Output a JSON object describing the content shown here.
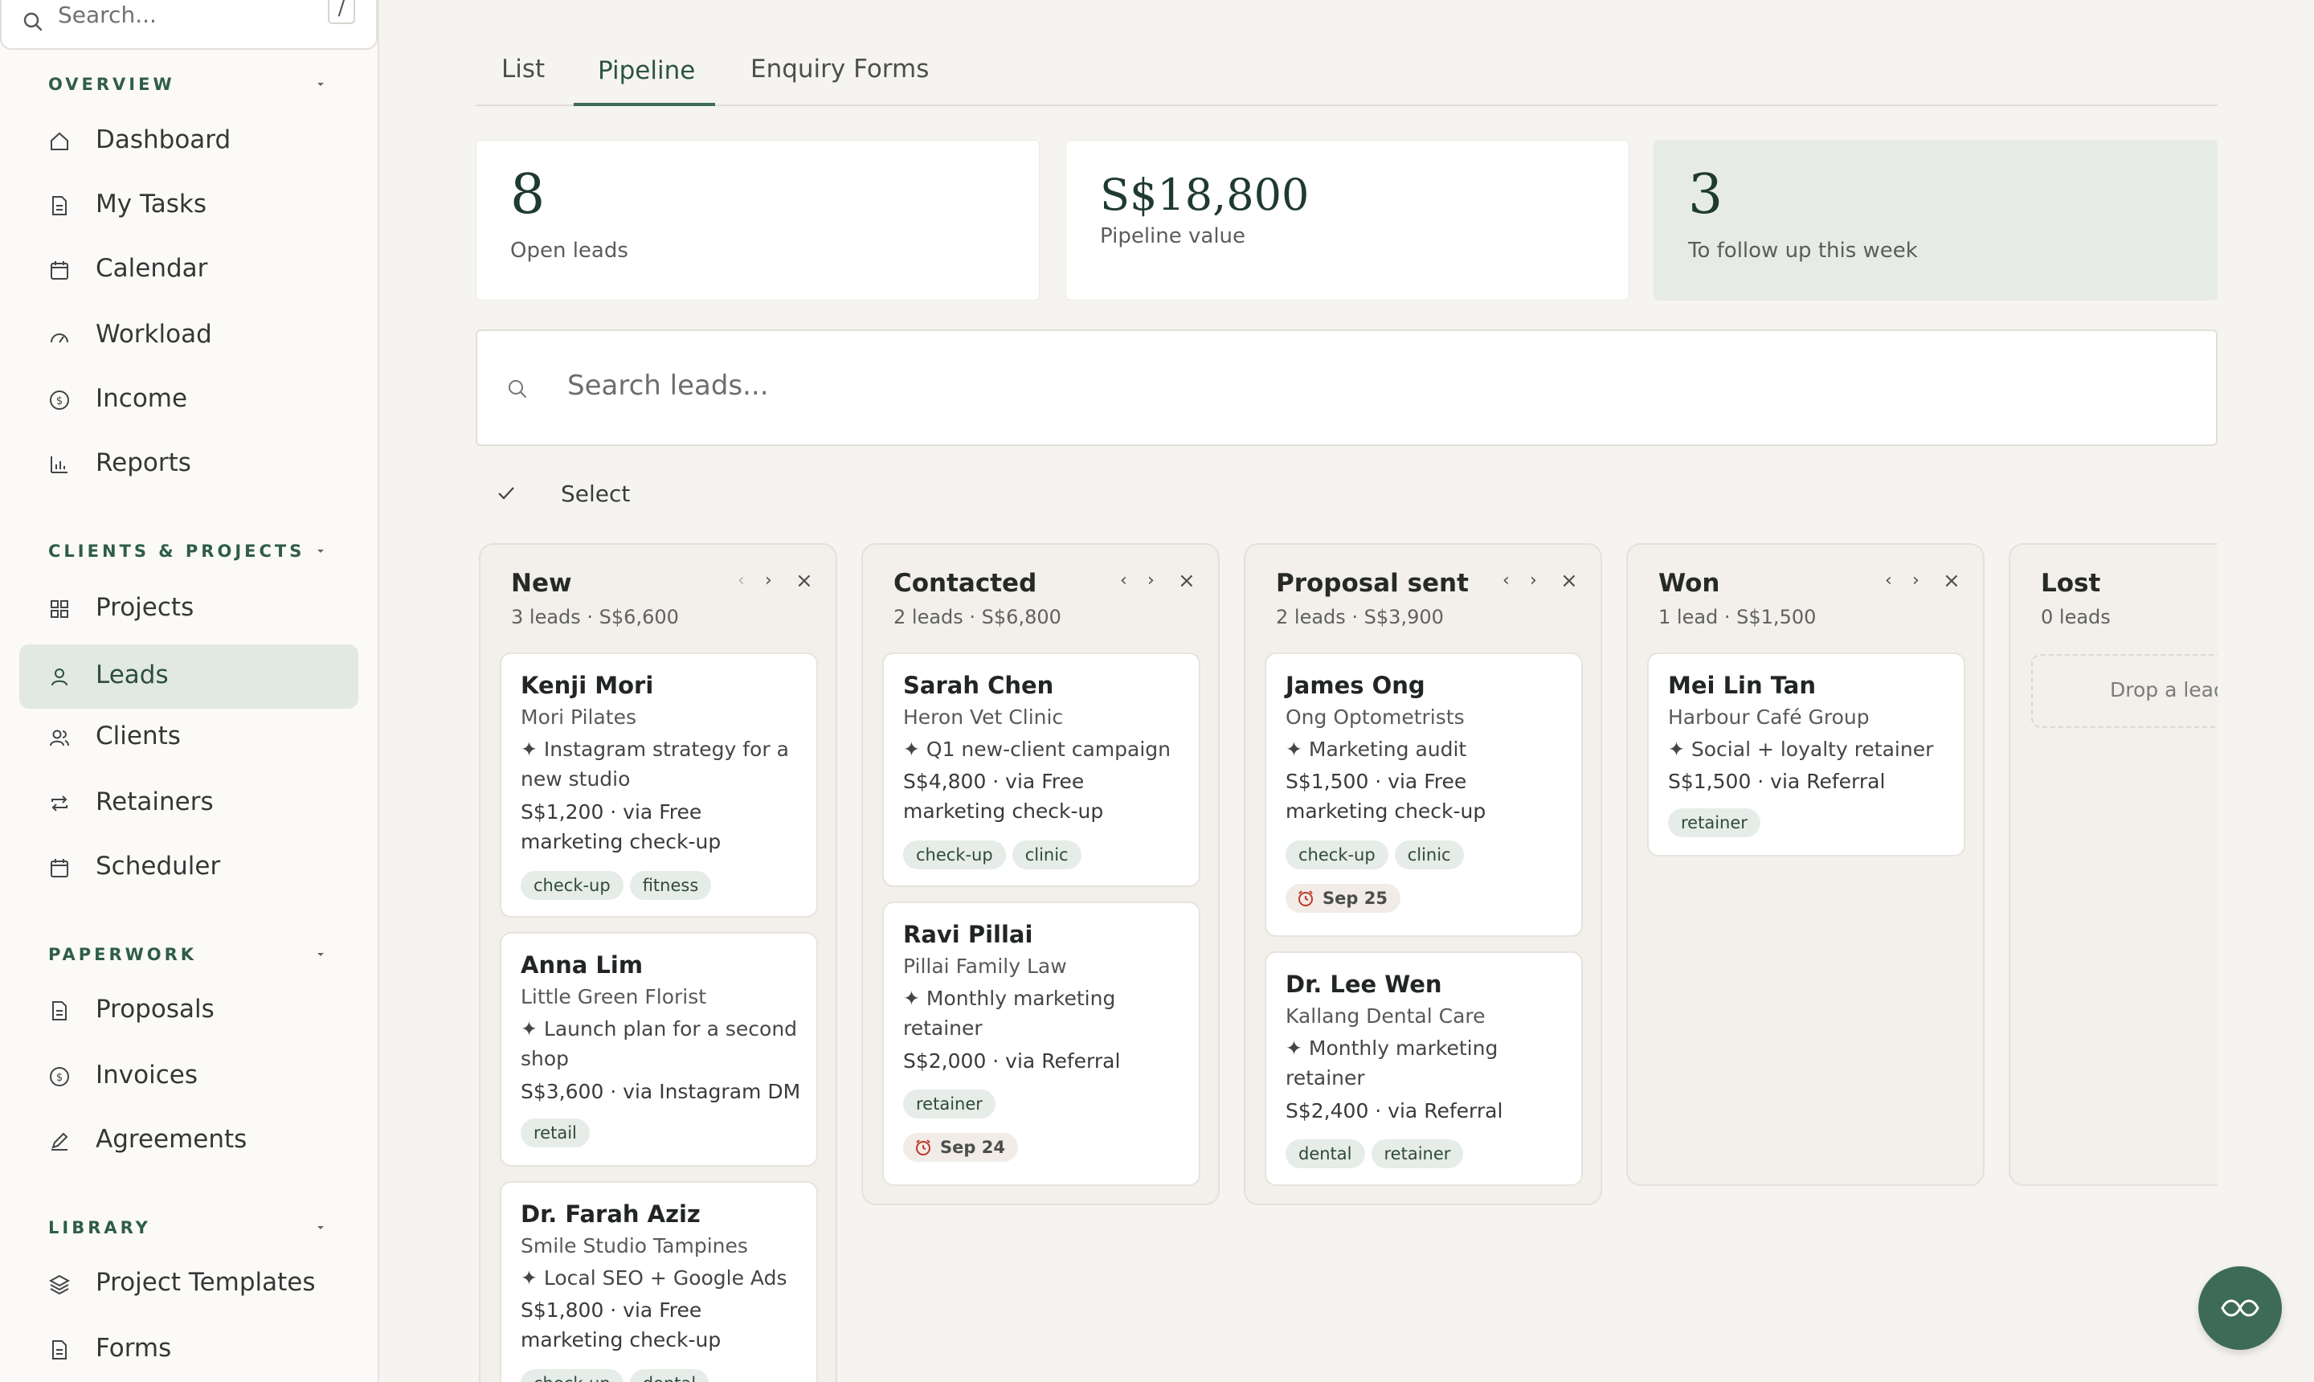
{
  "sidebar": {
    "search": {
      "placeholder": "Search...",
      "shortcut": "/"
    },
    "sections": [
      {
        "title": "OVERVIEW",
        "items": [
          {
            "label": "Dashboard",
            "icon": "home-icon"
          },
          {
            "label": "My Tasks",
            "icon": "document-icon"
          },
          {
            "label": "Calendar",
            "icon": "calendar-icon"
          },
          {
            "label": "Workload",
            "icon": "gauge-icon"
          },
          {
            "label": "Income",
            "icon": "dollar-icon"
          },
          {
            "label": "Reports",
            "icon": "bar-chart-icon"
          }
        ]
      },
      {
        "title": "CLIENTS & PROJECTS",
        "items": [
          {
            "label": "Projects",
            "icon": "grid-icon"
          },
          {
            "label": "Leads",
            "icon": "user-icon",
            "active": true
          },
          {
            "label": "Clients",
            "icon": "users-icon"
          },
          {
            "label": "Retainers",
            "icon": "repeat-icon"
          },
          {
            "label": "Scheduler",
            "icon": "calendar-icon"
          }
        ]
      },
      {
        "title": "PAPERWORK",
        "items": [
          {
            "label": "Proposals",
            "icon": "document-icon"
          },
          {
            "label": "Invoices",
            "icon": "dollar-icon"
          },
          {
            "label": "Agreements",
            "icon": "pen-icon"
          }
        ]
      },
      {
        "title": "LIBRARY",
        "items": [
          {
            "label": "Project Templates",
            "icon": "layers-icon"
          },
          {
            "label": "Forms",
            "icon": "document-icon"
          }
        ]
      }
    ]
  },
  "tabs": {
    "list": "List",
    "pipeline": "Pipeline",
    "enquiry": "Enquiry Forms",
    "active": "Pipeline"
  },
  "stats": {
    "open_leads": {
      "value": "8",
      "label": "Open leads"
    },
    "pipeline_value": {
      "value": "S$18,800",
      "label": "Pipeline value"
    },
    "follow_up": {
      "value": "3",
      "label": "To follow up this week"
    }
  },
  "lead_search": {
    "placeholder": "Search leads..."
  },
  "select_label": "Select",
  "columns": [
    {
      "title": "New",
      "summary": "3 leads · S$6,600",
      "cards": [
        {
          "name": "Kenji Mori",
          "company": "Mori Pilates",
          "desc": "✦ Instagram strategy for a new studio",
          "meta": "S$1,200 · via Free marketing check-up",
          "tags": [
            "check-up",
            "fitness"
          ]
        },
        {
          "name": "Anna Lim",
          "company": "Little Green Florist",
          "desc": "✦ Launch plan for a second shop",
          "meta": "S$3,600 · via Instagram DM",
          "tags": [
            "retail"
          ]
        },
        {
          "name": "Dr. Farah Aziz",
          "company": "Smile Studio Tampines",
          "desc": "✦ Local SEO + Google Ads",
          "meta": "S$1,800 · via Free marketing check-up",
          "tags": [
            "check-up",
            "dental"
          ]
        }
      ]
    },
    {
      "title": "Contacted",
      "summary": "2 leads · S$6,800",
      "cards": [
        {
          "name": "Sarah Chen",
          "company": "Heron Vet Clinic",
          "desc": "✦ Q1 new-client campaign",
          "meta": "S$4,800 · via Free marketing check-up",
          "tags": [
            "check-up",
            "clinic"
          ]
        },
        {
          "name": "Ravi Pillai",
          "company": "Pillai Family Law",
          "desc": "✦ Monthly marketing retainer",
          "meta": "S$2,000 · via Referral",
          "tags": [
            "retainer"
          ],
          "due": "Sep 24"
        }
      ]
    },
    {
      "title": "Proposal sent",
      "summary": "2 leads · S$3,900",
      "cards": [
        {
          "name": "James Ong",
          "company": "Ong Optometrists",
          "desc": "✦ Marketing audit",
          "meta": "S$1,500 · via Free marketing check-up",
          "tags": [
            "check-up",
            "clinic"
          ],
          "due": "Sep 25"
        },
        {
          "name": "Dr. Lee Wen",
          "company": "Kallang Dental Care",
          "desc": "✦ Monthly marketing retainer",
          "meta": "S$2,400 · via Referral",
          "tags": [
            "dental",
            "retainer"
          ]
        }
      ]
    },
    {
      "title": "Won",
      "summary": "1 lead · S$1,500",
      "cards": [
        {
          "name": "Mei Lin Tan",
          "company": "Harbour Café Group",
          "desc": "✦ Social + loyalty retainer",
          "meta": "S$1,500 · via Referral",
          "tags": [
            "retainer"
          ]
        }
      ]
    },
    {
      "title": "Lost",
      "summary": "0 leads",
      "dropzone": "Drop a lead here",
      "cards": []
    }
  ],
  "controls": {
    "prev": "‹",
    "next": "›",
    "close": "×"
  },
  "colors": {
    "accent": "#3e6b58",
    "active_nav": "#e2e8e4",
    "tag_bg": "#e6ece7",
    "due_clock": "#c0392b"
  }
}
